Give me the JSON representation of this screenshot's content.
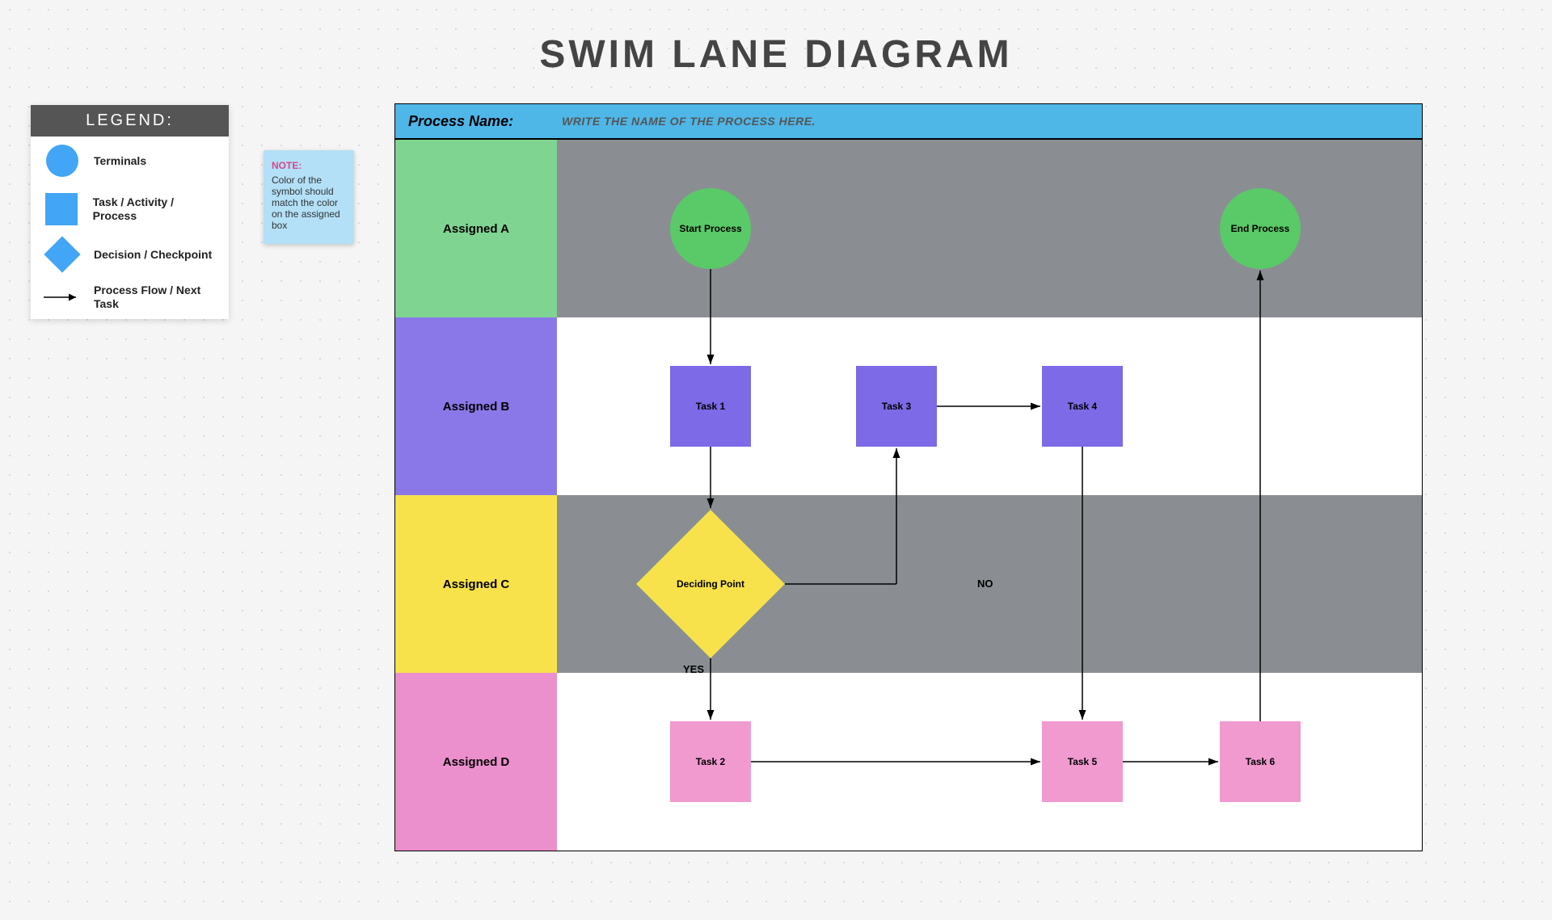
{
  "title": "SWIM LANE DIAGRAM",
  "legend": {
    "header": "LEGEND:",
    "items": [
      {
        "label": "Terminals"
      },
      {
        "label": "Task / Activity / Process"
      },
      {
        "label": "Decision / Checkpoint"
      },
      {
        "label": "Process Flow / Next Task"
      }
    ]
  },
  "note": {
    "title": "NOTE:",
    "text": "Color of the symbol should match the color on the assigned box"
  },
  "process_name": {
    "label": "Process Name:",
    "placeholder": "WRITE THE NAME OF THE PROCESS HERE."
  },
  "lanes": {
    "a": "Assigned A",
    "b": "Assigned B",
    "c": "Assigned C",
    "d": "Assigned D"
  },
  "nodes": {
    "start": "Start Process",
    "end": "End Process",
    "task1": "Task 1",
    "task2": "Task 2",
    "task3": "Task 3",
    "task4": "Task 4",
    "task5": "Task 5",
    "task6": "Task 6",
    "decision": "Deciding Point"
  },
  "edges": {
    "yes": "YES",
    "no": "NO"
  },
  "chart_data": {
    "type": "swimlane-flowchart",
    "title": "SWIM LANE DIAGRAM",
    "lanes": [
      {
        "id": "A",
        "label": "Assigned A",
        "color": "#7fd492"
      },
      {
        "id": "B",
        "label": "Assigned B",
        "color": "#8a78e8"
      },
      {
        "id": "C",
        "label": "Assigned C",
        "color": "#f7e24b"
      },
      {
        "id": "D",
        "label": "Assigned D",
        "color": "#ec8fcd"
      }
    ],
    "nodes": [
      {
        "id": "start",
        "lane": "A",
        "type": "terminal",
        "label": "Start Process"
      },
      {
        "id": "task1",
        "lane": "B",
        "type": "task",
        "label": "Task 1"
      },
      {
        "id": "decision",
        "lane": "C",
        "type": "decision",
        "label": "Deciding Point"
      },
      {
        "id": "task2",
        "lane": "D",
        "type": "task",
        "label": "Task 2"
      },
      {
        "id": "task3",
        "lane": "B",
        "type": "task",
        "label": "Task 3"
      },
      {
        "id": "task4",
        "lane": "B",
        "type": "task",
        "label": "Task 4"
      },
      {
        "id": "task5",
        "lane": "D",
        "type": "task",
        "label": "Task 5"
      },
      {
        "id": "task6",
        "lane": "D",
        "type": "task",
        "label": "Task 6"
      },
      {
        "id": "end",
        "lane": "A",
        "type": "terminal",
        "label": "End Process"
      }
    ],
    "edges": [
      {
        "from": "start",
        "to": "task1"
      },
      {
        "from": "task1",
        "to": "decision"
      },
      {
        "from": "decision",
        "to": "task3",
        "label": "NO"
      },
      {
        "from": "decision",
        "to": "task2",
        "label": "YES"
      },
      {
        "from": "task3",
        "to": "task4"
      },
      {
        "from": "task4",
        "to": "task5"
      },
      {
        "from": "task2",
        "to": "task5"
      },
      {
        "from": "task5",
        "to": "task6"
      },
      {
        "from": "task6",
        "to": "end"
      }
    ]
  }
}
